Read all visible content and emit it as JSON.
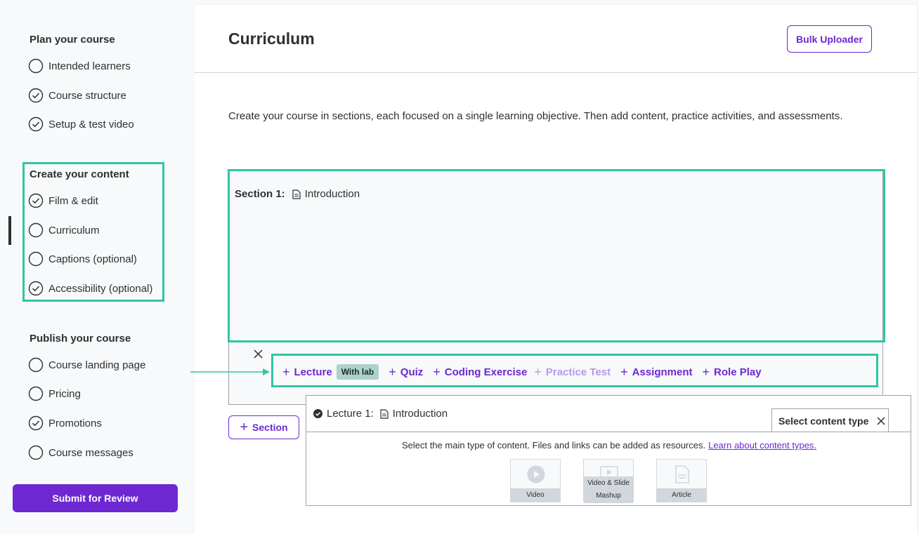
{
  "sidebar": {
    "groups": [
      {
        "title": "Plan your course",
        "items": [
          {
            "label": "Intended learners",
            "done": false
          },
          {
            "label": "Course structure",
            "done": true
          },
          {
            "label": "Setup & test video",
            "done": true
          }
        ]
      },
      {
        "title": "Create your content",
        "items": [
          {
            "label": "Film & edit",
            "done": true
          },
          {
            "label": "Curriculum",
            "done": false
          },
          {
            "label": "Captions (optional)",
            "done": false
          },
          {
            "label": "Accessibility (optional)",
            "done": true
          }
        ]
      },
      {
        "title": "Publish your course",
        "items": [
          {
            "label": "Course landing page",
            "done": false
          },
          {
            "label": "Pricing",
            "done": false
          },
          {
            "label": "Promotions",
            "done": true
          },
          {
            "label": "Course messages",
            "done": false
          }
        ]
      }
    ],
    "submit_label": "Submit for Review"
  },
  "main": {
    "title": "Curriculum",
    "bulk_label": "Bulk Uploader",
    "intro": "Create your course in sections, each focused on a single learning objective. Then add content, practice activities, and assessments.",
    "section": {
      "label": "Section 1:",
      "name": "Introduction",
      "lecture": {
        "label": "Lecture 1:",
        "name": "Introduction",
        "tab_label": "Select content type",
        "description": "Select the main type of content. Files and links can be added as resources.",
        "link_text": "Learn about content types.",
        "content_types": [
          {
            "label": "Video",
            "icon": "play-icon"
          },
          {
            "label_line1": "Video & Slide",
            "label_line2": "Mashup",
            "icon": "slide-video-icon"
          },
          {
            "label": "Article",
            "icon": "article-icon"
          }
        ]
      }
    },
    "add_bar": {
      "lecture": "Lecture",
      "lecture_badge": "With lab",
      "quiz": "Quiz",
      "coding": "Coding Exercise",
      "practice": "Practice Test",
      "assignment": "Assignment",
      "roleplay": "Role Play"
    },
    "section_button": "Section"
  },
  "colors": {
    "accent": "#6d28d2",
    "highlight": "#2ec6a3"
  }
}
